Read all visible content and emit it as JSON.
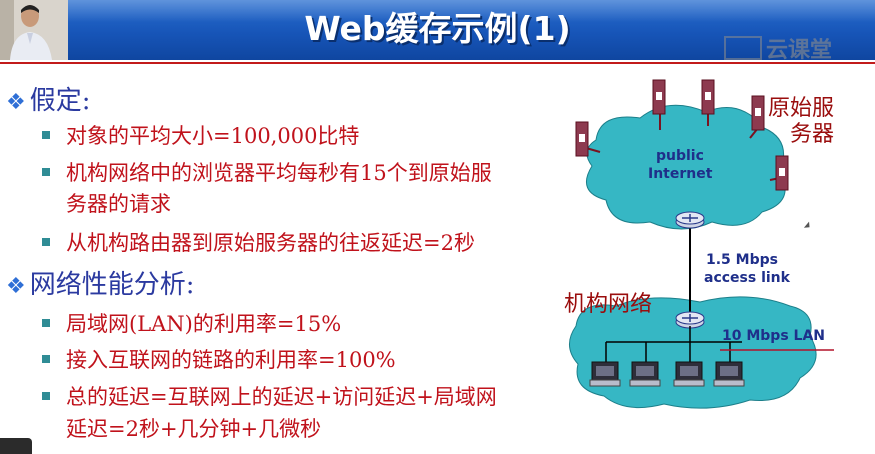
{
  "title": "Web缓存示例(1)",
  "watermark": "云课堂",
  "sections": [
    {
      "heading": "假定:",
      "items": [
        [
          "对象的平均大小=100,000比特"
        ],
        [
          "机构网络中的浏览器平均每秒有15个到原始服",
          "务器的请求"
        ],
        [
          "从机构路由器到原始服务器的往返延迟=2秒"
        ]
      ]
    },
    {
      "heading": "网络性能分析:",
      "items": [
        [
          "局域网(LAN)的利用率=15%"
        ],
        [
          "接入互联网的链路的利用率=100%"
        ],
        [
          "总的延迟=互联网上的延迟+访问延迟+局域网",
          "延迟=2秒+几分钟+几微秒"
        ]
      ]
    }
  ],
  "diagram": {
    "origin_servers_label": [
      "原始服",
      "务器"
    ],
    "internet_label": [
      "public",
      "Internet"
    ],
    "access_link_label": [
      "1.5 Mbps",
      "access link"
    ],
    "institution_label": "机构网络",
    "lan_label": "10 Mbps LAN"
  },
  "colors": {
    "title_bar": "#1755b8",
    "bullet_text": "#c0121b",
    "heading_text": "#2b3aa0",
    "cloud": "#36b7c4",
    "divider": "#c21b1b"
  }
}
